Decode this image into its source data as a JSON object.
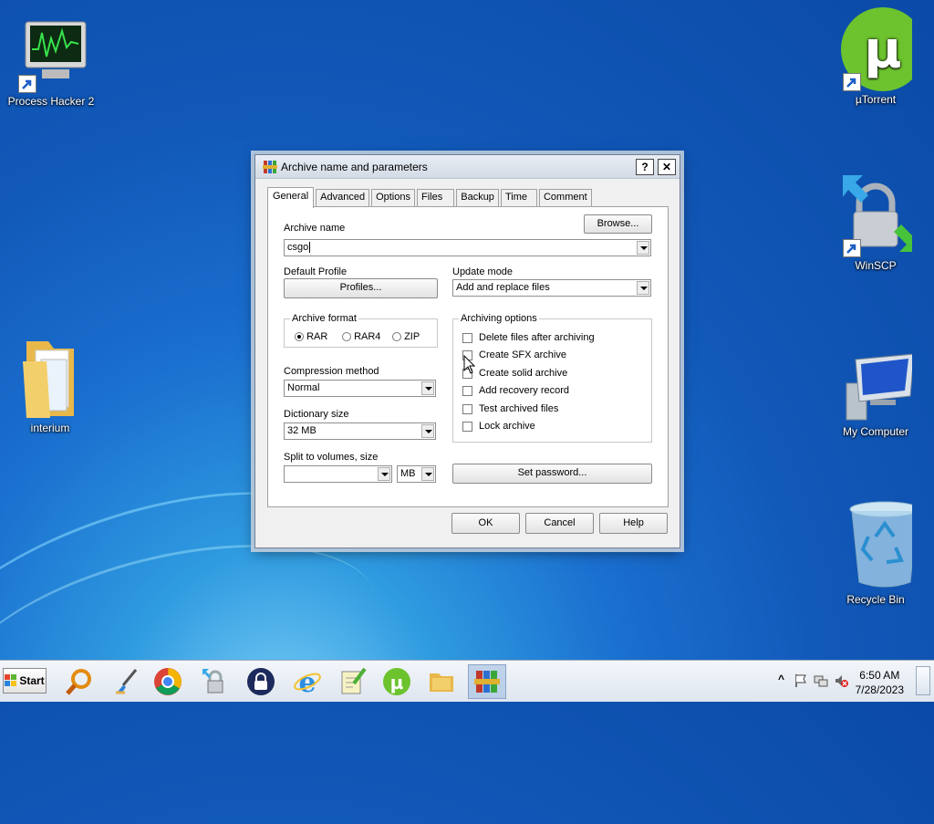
{
  "desktop": {
    "icons": {
      "process_hacker": "Process Hacker 2",
      "utorrent": "µTorrent",
      "winscp": "WinSCP",
      "interium": "interium",
      "my_computer": "My Computer",
      "recycle_bin": "Recycle Bin"
    }
  },
  "dialog": {
    "title": "Archive name and parameters",
    "help_btn": "?",
    "close_btn": "✕",
    "tabs": [
      "General",
      "Advanced",
      "Options",
      "Files",
      "Backup",
      "Time",
      "Comment"
    ],
    "archive_name_label": "Archive name",
    "browse_label": "Browse...",
    "archive_name_value": "csgo",
    "default_profile_label": "Default Profile",
    "profiles_label": "Profiles...",
    "update_mode_label": "Update mode",
    "update_mode_value": "Add and replace files",
    "archive_format": {
      "legend": "Archive format",
      "options": [
        "RAR",
        "RAR4",
        "ZIP"
      ],
      "selected": "RAR"
    },
    "compression_label": "Compression method",
    "compression_value": "Normal",
    "dictionary_label": "Dictionary size",
    "dictionary_value": "32 MB",
    "split_label": "Split to volumes, size",
    "split_value": "",
    "split_unit": "MB",
    "archiving_options": {
      "legend": "Archiving options",
      "items": [
        "Delete files after archiving",
        "Create SFX archive",
        "Create solid archive",
        "Add recovery record",
        "Test archived files",
        "Lock archive"
      ]
    },
    "set_password_label": "Set password...",
    "ok_label": "OK",
    "cancel_label": "Cancel",
    "help_label": "Help"
  },
  "taskbar": {
    "start_label": "Start",
    "time": "6:50 AM",
    "date": "7/28/2023",
    "tray_expand": "^"
  }
}
